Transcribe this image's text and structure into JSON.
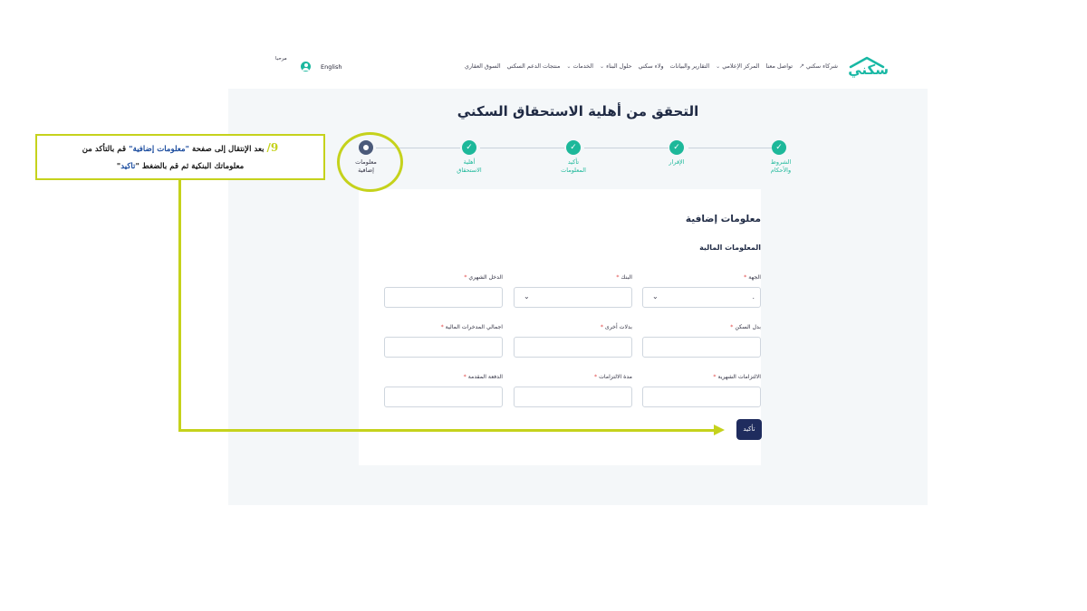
{
  "nav": {
    "logo_text": "سكني",
    "items": [
      {
        "label": "السوق العقاري",
        "has_dropdown": false
      },
      {
        "label": "منتجات الدعم السكني",
        "has_dropdown": false
      },
      {
        "label": "الخدمات",
        "has_dropdown": true
      },
      {
        "label": "حلول البناء",
        "has_dropdown": true
      },
      {
        "label": "ولاء سكني",
        "has_dropdown": false
      },
      {
        "label": "التقارير والبيانات",
        "has_dropdown": false
      },
      {
        "label": "المركز الإعلامي",
        "has_dropdown": true
      },
      {
        "label": "تواصل معنا",
        "has_dropdown": false
      },
      {
        "label": "شركاء سكني",
        "has_dropdown": false,
        "external": true
      }
    ],
    "greeting": "مرحبا",
    "language": "English"
  },
  "page": {
    "title": "التحقق من أهلية الاستحقاق السكني"
  },
  "stepper": {
    "steps": [
      {
        "label": "الشروط والأحكام",
        "status": "done"
      },
      {
        "label": "الإقرار",
        "status": "done"
      },
      {
        "label": "تأكيد المعلومات",
        "status": "done"
      },
      {
        "label": "أهلية الاستحقاق",
        "status": "done"
      },
      {
        "label": "معلومات إضافية",
        "status": "current"
      }
    ],
    "check_glyph": "✓"
  },
  "form": {
    "section_title": "معلومات إضافية",
    "subsection_title": "المعلومات المالية",
    "fields": [
      {
        "label": "الجهة",
        "required": true,
        "type": "select",
        "value": "."
      },
      {
        "label": "البنك",
        "required": true,
        "type": "select",
        "value": ""
      },
      {
        "label": "الدخل الشهري",
        "required": true,
        "type": "text",
        "value": ""
      },
      {
        "label": "بدل السكن",
        "required": true,
        "type": "text",
        "value": ""
      },
      {
        "label": "بدلات أخرى",
        "required": true,
        "type": "text",
        "value": ""
      },
      {
        "label": "اجمالي المدخرات المالية",
        "required": true,
        "type": "text",
        "value": ""
      },
      {
        "label": "الالتزامات الشهرية",
        "required": true,
        "type": "text",
        "value": ""
      },
      {
        "label": "مدة الالتزامات",
        "required": true,
        "type": "text",
        "value": ""
      },
      {
        "label": "الدفعة المقدمة",
        "required": true,
        "type": "text",
        "value": ""
      }
    ],
    "required_mark": "*",
    "confirm_label": "تأكيد"
  },
  "annotation": {
    "step_number": "9/",
    "line1_prefix": "بعد الإنتقال إلى صفحة",
    "line1_highlight": "\"معلومات إضافية\"",
    "line1_suffix": "قم بالتأكد من",
    "line2_prefix": "معلوماتك البنكية ثم قم بالضغط \"",
    "line2_highlight": "تاكيد",
    "line2_suffix": "\"",
    "accent_color": "#c5d21c"
  }
}
